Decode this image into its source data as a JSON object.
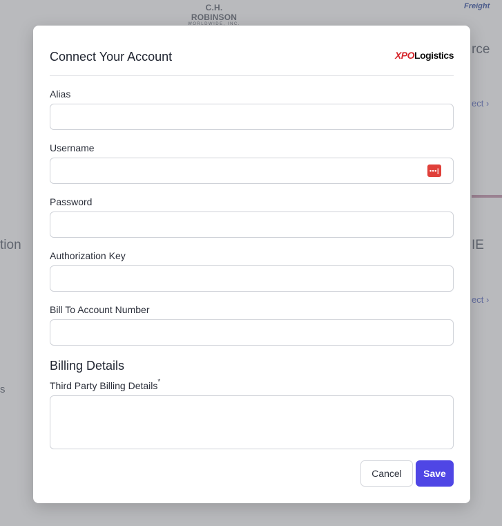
{
  "background": {
    "chr_logo_main": "C.H. ROBINSON",
    "chr_logo_sub": "WORLDWIDE, INC.",
    "freight_logo": "Freight",
    "text_left_1": "tion",
    "text_left_2": "s",
    "text_right_1": "rce",
    "text_right_2": "IE",
    "connect_link_1": "ect ›",
    "connect_link_2": "ect ›"
  },
  "modal": {
    "title": "Connect Your Account",
    "carrier_logo": {
      "part1": "XPO",
      "part2": "Logistics"
    },
    "fields": {
      "alias": {
        "label": "Alias",
        "value": "",
        "placeholder": ""
      },
      "username": {
        "label": "Username",
        "value": "",
        "placeholder": ""
      },
      "password": {
        "label": "Password",
        "value": "",
        "placeholder": ""
      },
      "auth_key": {
        "label": "Authorization Key",
        "value": "",
        "placeholder": ""
      },
      "bill_to": {
        "label": "Bill To Account Number",
        "value": "",
        "placeholder": ""
      }
    },
    "billing": {
      "heading": "Billing Details",
      "third_party_label": "Third Party Billing Details",
      "required_mark": "*",
      "third_party_value": ""
    },
    "buttons": {
      "cancel": "Cancel",
      "save": "Save"
    },
    "colors": {
      "primary": "#4f46e5",
      "password_manager_icon": "#e0403a",
      "logo_red": "#d6262b"
    },
    "icons": {
      "password_manager": "password-manager-icon"
    }
  }
}
